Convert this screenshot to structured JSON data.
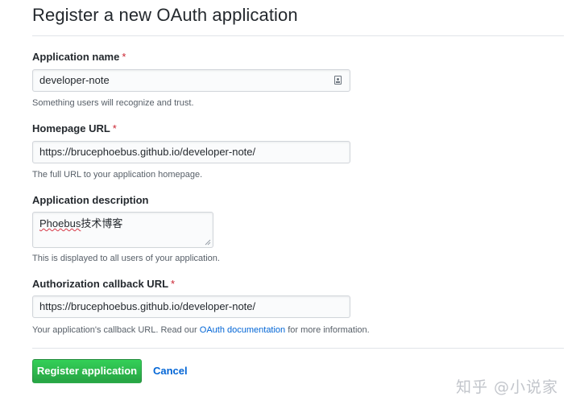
{
  "page": {
    "title": "Register a new OAuth application"
  },
  "form": {
    "app_name": {
      "label": "Application name",
      "required_mark": "*",
      "value": "developer-note",
      "hint": "Something users will recognize and trust."
    },
    "homepage_url": {
      "label": "Homepage URL",
      "required_mark": "*",
      "value": "https://brucephoebus.github.io/developer-note/",
      "hint": "The full URL to your application homepage."
    },
    "description": {
      "label": "Application description",
      "value_underlined": "Phoebus",
      "value_rest": "技术博客",
      "hint": "This is displayed to all users of your application."
    },
    "callback_url": {
      "label": "Authorization callback URL",
      "required_mark": "*",
      "value": "https://brucephoebus.github.io/developer-note/",
      "hint_before": "Your application's callback URL. Read our ",
      "hint_link": "OAuth documentation",
      "hint_after": " for more information."
    }
  },
  "actions": {
    "register_label": "Register application",
    "cancel_label": "Cancel"
  },
  "watermark": {
    "text": "知乎 @小说家"
  },
  "colors": {
    "accent_green": "#28a745",
    "link_blue": "#0366d6",
    "required_red": "#cb2431"
  },
  "icons": {
    "app_name_field_icon": "contact-card-icon",
    "textarea_resize": "resize-grip-icon"
  }
}
